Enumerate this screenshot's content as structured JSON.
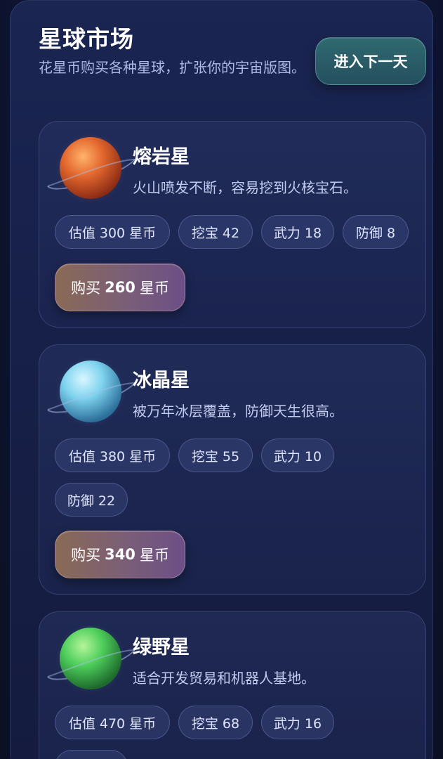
{
  "header": {
    "title": "星球市场",
    "subtitle": "花星币购买各种星球，扩张你的宇宙版图。",
    "next_day_label": "进入下一天"
  },
  "planets": [
    {
      "name": "熔岩星",
      "desc": "火山喷发不断，容易挖到火核宝石。",
      "chips": [
        "估值 300 星币",
        "挖宝 42",
        "武力 18",
        "防御 8"
      ],
      "buy_prefix": "购买",
      "buy_price": "260",
      "buy_suffix": "星币",
      "color": "#e3682e"
    },
    {
      "name": "冰晶星",
      "desc": "被万年冰层覆盖，防御天生很高。",
      "chips": [
        "估值 380 星币",
        "挖宝 55",
        "武力 10",
        "防御 22"
      ],
      "buy_prefix": "购买",
      "buy_price": "340",
      "buy_suffix": "星币",
      "color": "#7fd4ef"
    },
    {
      "name": "绿野星",
      "desc": "适合开发贸易和机器人基地。",
      "chips": [
        "估值 470 星币",
        "挖宝 68",
        "武力 16"
      ],
      "color": "#4fcf5c"
    }
  ],
  "icons": {
    "planet_1": "lava-planet-icon",
    "planet_2": "ice-planet-icon",
    "planet_3": "green-planet-icon"
  }
}
